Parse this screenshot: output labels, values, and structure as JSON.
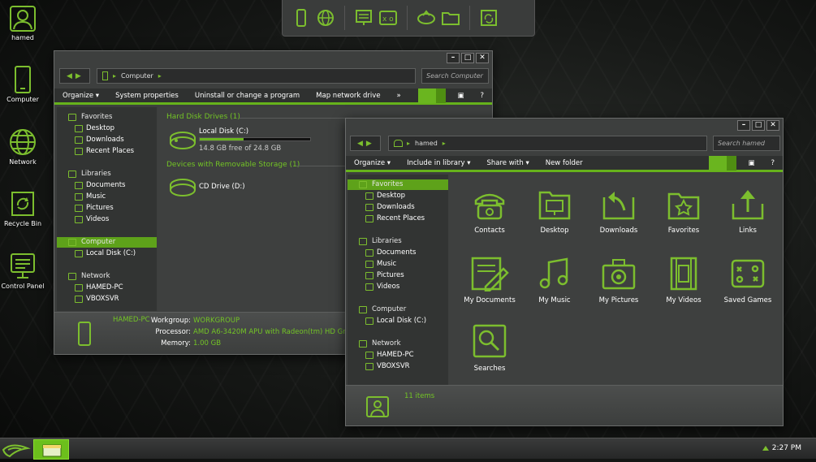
{
  "desktop": {
    "icons": [
      {
        "label": "hamed",
        "icon": "user-icon"
      },
      {
        "label": "Computer",
        "icon": "computer-icon"
      },
      {
        "label": "Network",
        "icon": "globe-icon"
      },
      {
        "label": "Recycle Bin",
        "icon": "recycle-icon"
      },
      {
        "label": "Control Panel",
        "icon": "control-panel-icon"
      }
    ]
  },
  "topbar": {
    "icons": [
      "phone-icon",
      "globe-icon",
      "monitor-list-icon",
      "gamepad-icon",
      "network-drive-icon",
      "folder-icon",
      "recycle-icon"
    ]
  },
  "win1": {
    "address": "Computer",
    "search_placeholder": "Search Computer",
    "commands": [
      "Organize",
      "System properties",
      "Uninstall or change a program",
      "Map network drive",
      "»"
    ],
    "nav": {
      "favorites": "Favorites",
      "fav_items": [
        "Desktop",
        "Downloads",
        "Recent Places"
      ],
      "libraries": "Libraries",
      "lib_items": [
        "Documents",
        "Music",
        "Pictures",
        "Videos"
      ],
      "computer": "Computer",
      "comp_items": [
        "Local Disk (C:)"
      ],
      "network": "Network",
      "net_items": [
        "HAMED-PC",
        "VBOXSVR"
      ]
    },
    "group1": "Hard Disk Drives (1)",
    "drive_name": "Local Disk (C:)",
    "drive_free": "14.8 GB free of 24.8 GB",
    "drive_used_fraction": 0.4,
    "group2": "Devices with Removable Storage (1)",
    "cd_name": "CD Drive (D:)",
    "details": {
      "name": "HAMED-PC",
      "workgroup_label": "Workgroup:",
      "workgroup": "WORKGROUP",
      "processor_label": "Processor:",
      "processor": "AMD A6-3420M APU with Radeon(tm) HD Graphics",
      "memory_label": "Memory:",
      "memory": "1.00 GB"
    }
  },
  "win2": {
    "address": "hamed",
    "search_placeholder": "Search hamed",
    "commands": [
      "Organize",
      "Include in library",
      "Share with",
      "New folder"
    ],
    "nav": {
      "favorites": "Favorites",
      "fav_items": [
        "Desktop",
        "Downloads",
        "Recent Places"
      ],
      "libraries": "Libraries",
      "lib_items": [
        "Documents",
        "Music",
        "Pictures",
        "Videos"
      ],
      "computer": "Computer",
      "comp_items": [
        "Local Disk (C:)"
      ],
      "network": "Network",
      "net_items": [
        "HAMED-PC",
        "VBOXSVR"
      ]
    },
    "items": [
      "Contacts",
      "Desktop",
      "Downloads",
      "Favorites",
      "Links",
      "My Documents",
      "My Music",
      "My Pictures",
      "My Videos",
      "Saved Games",
      "Searches"
    ],
    "status": "11 items"
  },
  "taskbar": {
    "clock": "2:27 PM"
  },
  "colors": {
    "accent": "#6ab51f",
    "text_green": "#73c425"
  }
}
